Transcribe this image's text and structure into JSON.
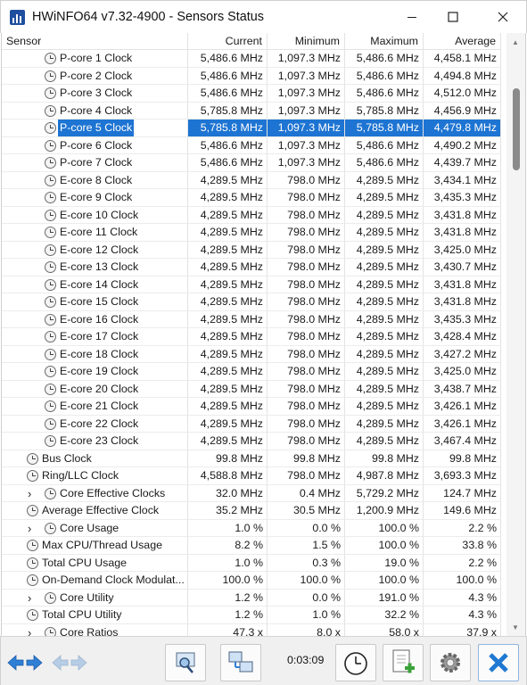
{
  "window": {
    "title": "HWiNFO64 v7.32-4900 - Sensors Status"
  },
  "columns": {
    "sensor": "Sensor",
    "current": "Current",
    "minimum": "Minimum",
    "maximum": "Maximum",
    "average": "Average"
  },
  "rows": [
    {
      "icon": "clock-icon",
      "level": 2,
      "label": "P-core 1 Clock",
      "current": "5,486.6 MHz",
      "min": "1,097.3 MHz",
      "max": "5,486.6 MHz",
      "avg": "4,458.1 MHz"
    },
    {
      "icon": "clock-icon",
      "level": 2,
      "label": "P-core 2 Clock",
      "current": "5,486.6 MHz",
      "min": "1,097.3 MHz",
      "max": "5,486.6 MHz",
      "avg": "4,494.8 MHz"
    },
    {
      "icon": "clock-icon",
      "level": 2,
      "label": "P-core 3 Clock",
      "current": "5,486.6 MHz",
      "min": "1,097.3 MHz",
      "max": "5,486.6 MHz",
      "avg": "4,512.0 MHz"
    },
    {
      "icon": "clock-icon",
      "level": 2,
      "label": "P-core 4 Clock",
      "current": "5,785.8 MHz",
      "min": "1,097.3 MHz",
      "max": "5,785.8 MHz",
      "avg": "4,456.9 MHz"
    },
    {
      "icon": "clock-icon",
      "level": 2,
      "label": "P-core 5 Clock",
      "current": "5,785.8 MHz",
      "min": "1,097.3 MHz",
      "max": "5,785.8 MHz",
      "avg": "4,479.8 MHz",
      "selected": true
    },
    {
      "icon": "clock-icon",
      "level": 2,
      "label": "P-core 6 Clock",
      "current": "5,486.6 MHz",
      "min": "1,097.3 MHz",
      "max": "5,486.6 MHz",
      "avg": "4,490.2 MHz"
    },
    {
      "icon": "clock-icon",
      "level": 2,
      "label": "P-core 7 Clock",
      "current": "5,486.6 MHz",
      "min": "1,097.3 MHz",
      "max": "5,486.6 MHz",
      "avg": "4,439.7 MHz"
    },
    {
      "icon": "clock-icon",
      "level": 2,
      "label": "E-core 8 Clock",
      "current": "4,289.5 MHz",
      "min": "798.0 MHz",
      "max": "4,289.5 MHz",
      "avg": "3,434.1 MHz"
    },
    {
      "icon": "clock-icon",
      "level": 2,
      "label": "E-core 9 Clock",
      "current": "4,289.5 MHz",
      "min": "798.0 MHz",
      "max": "4,289.5 MHz",
      "avg": "3,435.3 MHz"
    },
    {
      "icon": "clock-icon",
      "level": 2,
      "label": "E-core 10 Clock",
      "current": "4,289.5 MHz",
      "min": "798.0 MHz",
      "max": "4,289.5 MHz",
      "avg": "3,431.8 MHz"
    },
    {
      "icon": "clock-icon",
      "level": 2,
      "label": "E-core 11 Clock",
      "current": "4,289.5 MHz",
      "min": "798.0 MHz",
      "max": "4,289.5 MHz",
      "avg": "3,431.8 MHz"
    },
    {
      "icon": "clock-icon",
      "level": 2,
      "label": "E-core 12 Clock",
      "current": "4,289.5 MHz",
      "min": "798.0 MHz",
      "max": "4,289.5 MHz",
      "avg": "3,425.0 MHz"
    },
    {
      "icon": "clock-icon",
      "level": 2,
      "label": "E-core 13 Clock",
      "current": "4,289.5 MHz",
      "min": "798.0 MHz",
      "max": "4,289.5 MHz",
      "avg": "3,430.7 MHz"
    },
    {
      "icon": "clock-icon",
      "level": 2,
      "label": "E-core 14 Clock",
      "current": "4,289.5 MHz",
      "min": "798.0 MHz",
      "max": "4,289.5 MHz",
      "avg": "3,431.8 MHz"
    },
    {
      "icon": "clock-icon",
      "level": 2,
      "label": "E-core 15 Clock",
      "current": "4,289.5 MHz",
      "min": "798.0 MHz",
      "max": "4,289.5 MHz",
      "avg": "3,431.8 MHz"
    },
    {
      "icon": "clock-icon",
      "level": 2,
      "label": "E-core 16 Clock",
      "current": "4,289.5 MHz",
      "min": "798.0 MHz",
      "max": "4,289.5 MHz",
      "avg": "3,435.3 MHz"
    },
    {
      "icon": "clock-icon",
      "level": 2,
      "label": "E-core 17 Clock",
      "current": "4,289.5 MHz",
      "min": "798.0 MHz",
      "max": "4,289.5 MHz",
      "avg": "3,428.4 MHz"
    },
    {
      "icon": "clock-icon",
      "level": 2,
      "label": "E-core 18 Clock",
      "current": "4,289.5 MHz",
      "min": "798.0 MHz",
      "max": "4,289.5 MHz",
      "avg": "3,427.2 MHz"
    },
    {
      "icon": "clock-icon",
      "level": 2,
      "label": "E-core 19 Clock",
      "current": "4,289.5 MHz",
      "min": "798.0 MHz",
      "max": "4,289.5 MHz",
      "avg": "3,425.0 MHz"
    },
    {
      "icon": "clock-icon",
      "level": 2,
      "label": "E-core 20 Clock",
      "current": "4,289.5 MHz",
      "min": "798.0 MHz",
      "max": "4,289.5 MHz",
      "avg": "3,438.7 MHz"
    },
    {
      "icon": "clock-icon",
      "level": 2,
      "label": "E-core 21 Clock",
      "current": "4,289.5 MHz",
      "min": "798.0 MHz",
      "max": "4,289.5 MHz",
      "avg": "3,426.1 MHz"
    },
    {
      "icon": "clock-icon",
      "level": 2,
      "label": "E-core 22 Clock",
      "current": "4,289.5 MHz",
      "min": "798.0 MHz",
      "max": "4,289.5 MHz",
      "avg": "3,426.1 MHz"
    },
    {
      "icon": "clock-icon",
      "level": 2,
      "label": "E-core 23 Clock",
      "current": "4,289.5 MHz",
      "min": "798.0 MHz",
      "max": "4,289.5 MHz",
      "avg": "3,467.4 MHz"
    },
    {
      "icon": "clock-icon",
      "level": 1,
      "label": "Bus Clock",
      "current": "99.8 MHz",
      "min": "99.8 MHz",
      "max": "99.8 MHz",
      "avg": "99.8 MHz"
    },
    {
      "icon": "clock-icon",
      "level": 1,
      "label": "Ring/LLC Clock",
      "current": "4,588.8 MHz",
      "min": "798.0 MHz",
      "max": "4,987.8 MHz",
      "avg": "3,693.3 MHz"
    },
    {
      "icon": "clock-icon",
      "level": 1,
      "expandable": true,
      "label": "Core Effective Clocks",
      "current": "32.0 MHz",
      "min": "0.4 MHz",
      "max": "5,729.2 MHz",
      "avg": "124.7 MHz"
    },
    {
      "icon": "clock-icon",
      "level": 1,
      "label": "Average Effective Clock",
      "current": "35.2 MHz",
      "min": "30.5 MHz",
      "max": "1,200.9 MHz",
      "avg": "149.6 MHz"
    },
    {
      "icon": "clock-icon",
      "level": 1,
      "expandable": true,
      "label": "Core Usage",
      "current": "1.0 %",
      "min": "0.0 %",
      "max": "100.0 %",
      "avg": "2.2 %"
    },
    {
      "icon": "clock-icon",
      "level": 1,
      "label": "Max CPU/Thread Usage",
      "current": "8.2 %",
      "min": "1.5 %",
      "max": "100.0 %",
      "avg": "33.8 %"
    },
    {
      "icon": "clock-icon",
      "level": 1,
      "label": "Total CPU Usage",
      "current": "1.0 %",
      "min": "0.3 %",
      "max": "19.0 %",
      "avg": "2.2 %"
    },
    {
      "icon": "clock-icon",
      "level": 1,
      "label": "On-Demand Clock Modulat...",
      "current": "100.0 %",
      "min": "100.0 %",
      "max": "100.0 %",
      "avg": "100.0 %"
    },
    {
      "icon": "clock-icon",
      "level": 1,
      "expandable": true,
      "label": "Core Utility",
      "current": "1.2 %",
      "min": "0.0 %",
      "max": "191.0 %",
      "avg": "4.3 %"
    },
    {
      "icon": "clock-icon",
      "level": 1,
      "label": "Total CPU Utility",
      "current": "1.2 %",
      "min": "1.0 %",
      "max": "32.2 %",
      "avg": "4.3 %"
    },
    {
      "icon": "clock-icon",
      "level": 1,
      "expandable": true,
      "label": "Core Ratios",
      "current": "47.3 x",
      "min": "8.0 x",
      "max": "58.0 x",
      "avg": "37.9 x"
    }
  ],
  "toolbar": {
    "timer": "0:03:09"
  },
  "colors": {
    "selection": "#1e74d2",
    "accent_blue": "#1f78d1"
  }
}
